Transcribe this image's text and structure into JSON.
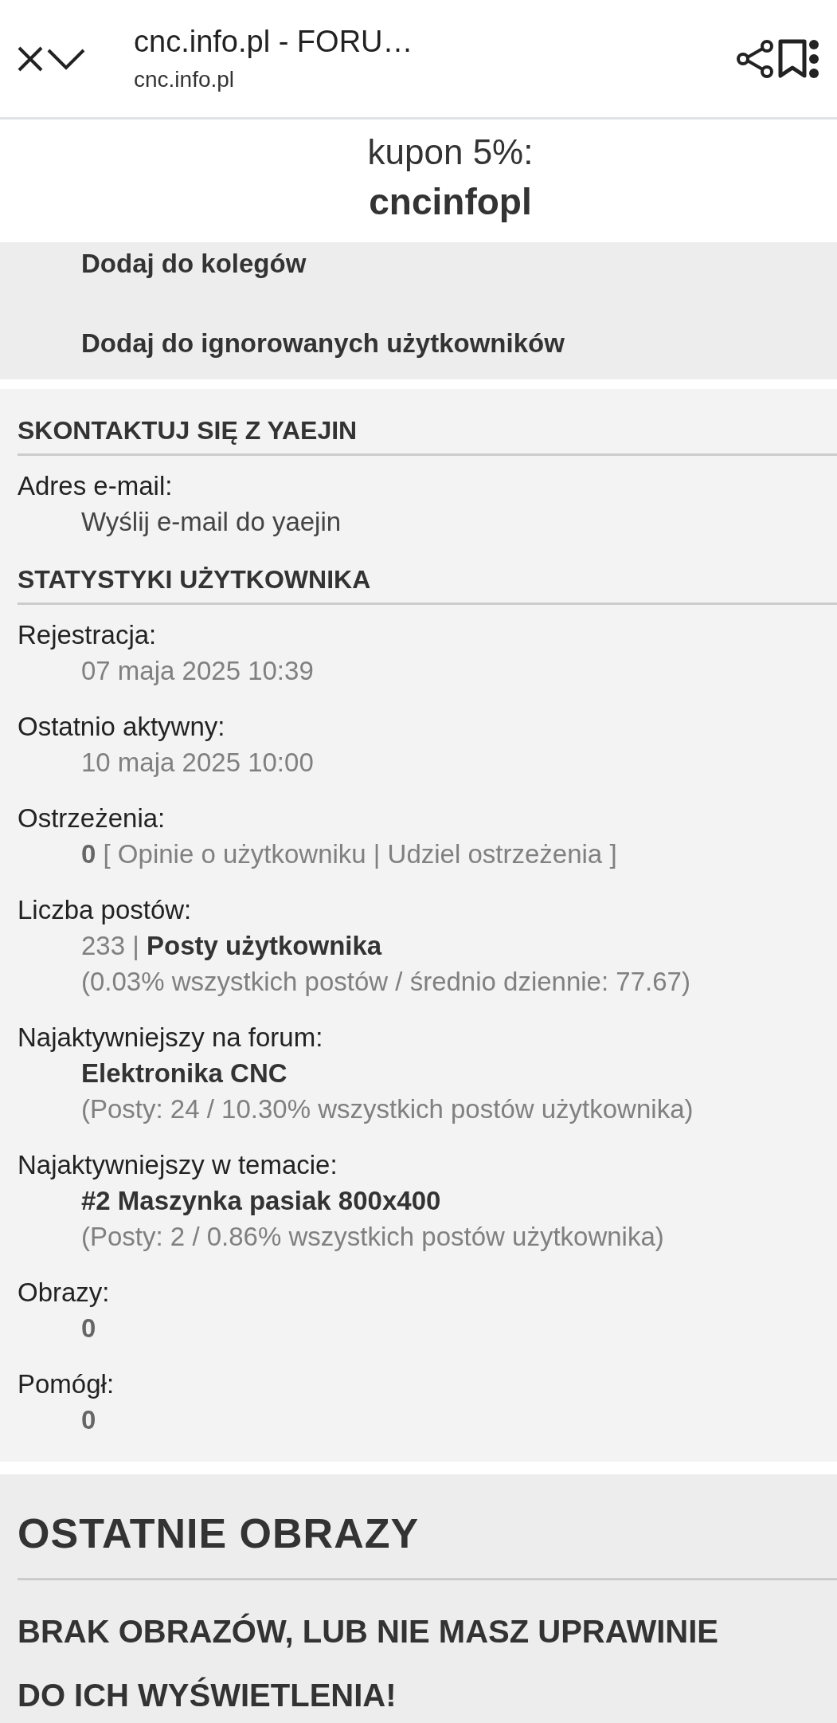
{
  "browser_bar": {
    "title": "cnc.info.pl - FORU…",
    "url": "cnc.info.pl"
  },
  "promo": {
    "text": "kupon 5%:",
    "code": "cncinfopl"
  },
  "actions": [
    "Dodaj do kolegów",
    "Dodaj do ignorowanych użytkowników"
  ],
  "sections": [
    {
      "title": "SKONTAKTUJ SIĘ Z YAEJIN",
      "fields": [
        {
          "label": "Adres e-mail:",
          "lines": [
            {
              "kind": "plain",
              "text": "Wyślij e-mail do yaejin"
            }
          ]
        }
      ]
    },
    {
      "title": "STATYSTYKI UŻYTKOWNIKA",
      "fields": [
        {
          "label": "Rejestracja:",
          "lines": [
            {
              "kind": "muted",
              "text": "07 maja 2025 10:39"
            }
          ]
        },
        {
          "label": "Ostatnio aktywny:",
          "lines": [
            {
              "kind": "muted",
              "text": "10 maja 2025 10:00"
            }
          ]
        },
        {
          "label": "Ostrzeżenia:",
          "lines": [
            {
              "kind": "muted",
              "text": "**0** [ Opinie o użytkowniku | Udziel ostrzeżenia ]"
            }
          ]
        },
        {
          "label": "Liczba postów:",
          "lines": [
            {
              "kind": "mixed",
              "text": "233 | **Posty użytkownika**"
            },
            {
              "kind": "muted",
              "text": "(0.03% wszystkich postów / średnio dziennie: 77.67)"
            }
          ]
        },
        {
          "label": "Najaktywniejszy na forum:",
          "lines": [
            {
              "kind": "strong",
              "text": "Elektronika CNC"
            },
            {
              "kind": "muted",
              "text": "(Posty: 24 / 10.30% wszystkich postów użytkownika)"
            }
          ]
        },
        {
          "label": "Najaktywniejszy w temacie:",
          "lines": [
            {
              "kind": "strong",
              "text": "#2 Maszynka pasiak 800x400"
            },
            {
              "kind": "muted",
              "text": "(Posty: 2 / 0.86% wszystkich postów użytkownika)"
            }
          ]
        },
        {
          "label": "Obrazy:",
          "lines": [
            {
              "kind": "count",
              "text": "0"
            }
          ]
        },
        {
          "label": "Pomógł:",
          "lines": [
            {
              "kind": "count",
              "text": "0"
            }
          ]
        }
      ]
    }
  ],
  "recent_images": {
    "title": "OSTATNIE OBRAZY",
    "message_lines": [
      "BRAK OBRAZÓW, LUB NIE MASZ UPRAWINIE",
      "DO ICH WYŚWIETLENIA!"
    ]
  }
}
